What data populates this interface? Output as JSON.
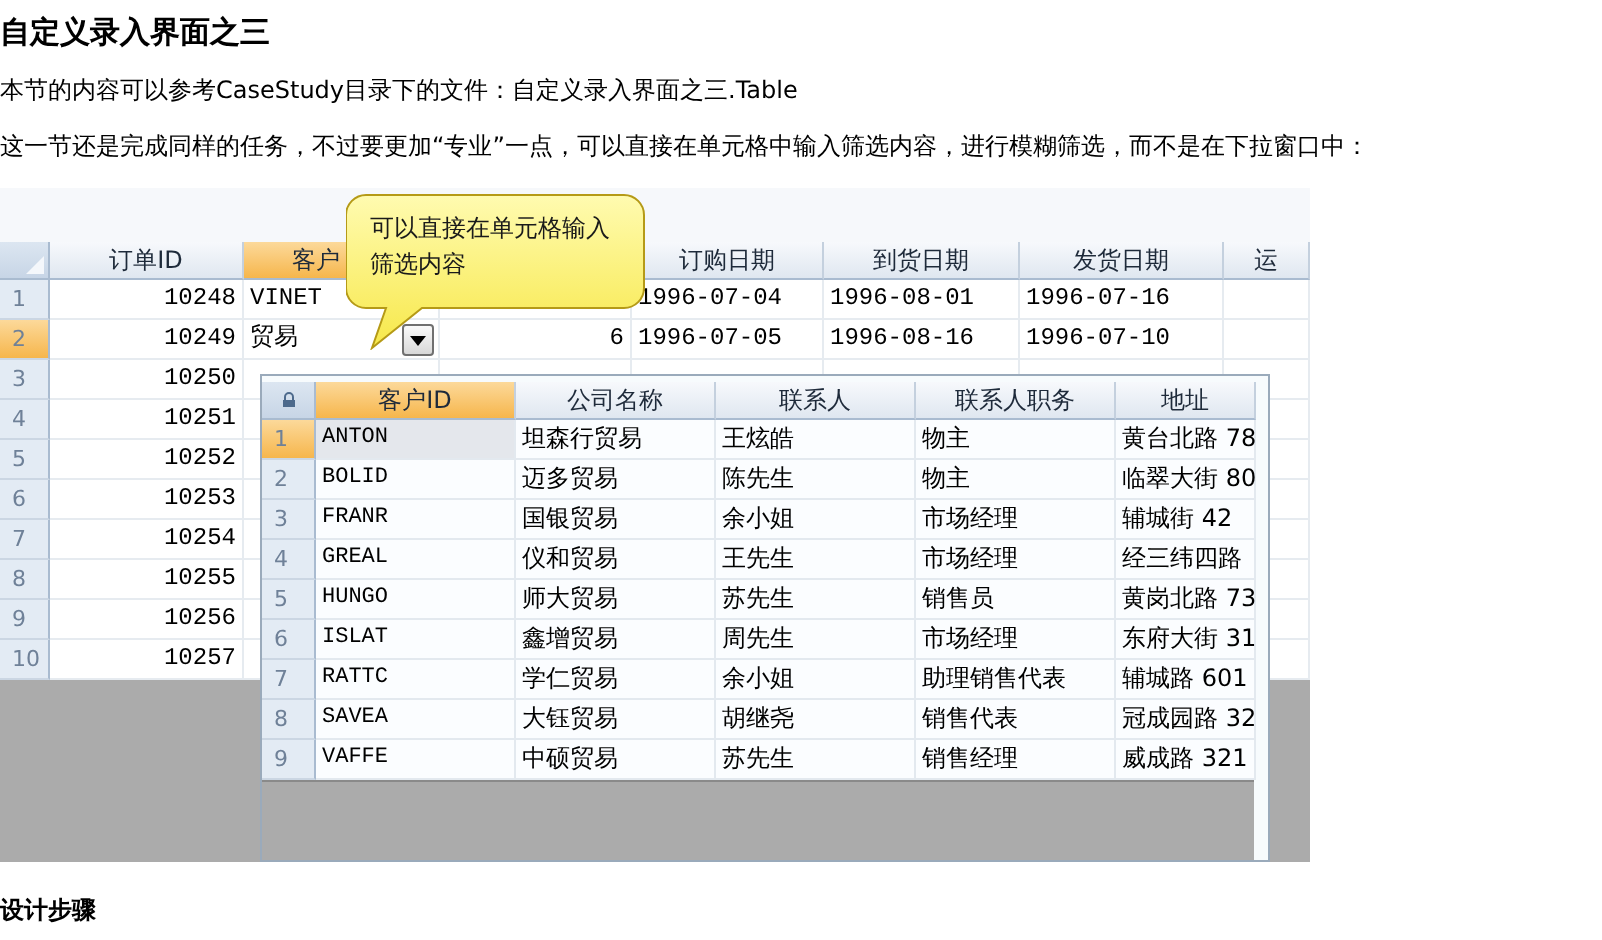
{
  "title": "自定义录入界面之三",
  "intro": "本节的内容可以参考CaseStudy目录下的文件：自定义录入界面之三.Table",
  "description": "这一节还是完成同样的任务，不过要更加“专业”一点，可以直接在单元格中输入筛选内容，进行模糊筛选，而不是在下拉窗口中：",
  "grid": {
    "columns": [
      {
        "label": "订单ID",
        "selected": false
      },
      {
        "label": "客户",
        "selected": true
      },
      {},
      {
        "label": "订购日期",
        "selected": false
      },
      {
        "label": "到货日期",
        "selected": false
      },
      {
        "label": "发货日期",
        "selected": false
      },
      {
        "label": "运",
        "selected": false
      }
    ],
    "rows": [
      {
        "header": "1",
        "selected": false,
        "order_id": "10248",
        "customer": "VINET",
        "order_date": "1996-07-04",
        "arrival_date": "1996-08-01",
        "ship_date": "1996-07-16"
      },
      {
        "header": "2",
        "selected": true,
        "order_id": "10249",
        "customer": "贸易",
        "column_3": "6",
        "order_date": "1996-07-05",
        "arrival_date": "1996-08-16",
        "ship_date": "1996-07-10"
      },
      {
        "header": "3",
        "selected": false,
        "order_id": "10250"
      },
      {
        "header": "4",
        "selected": false,
        "order_id": "10251"
      },
      {
        "header": "5",
        "selected": false,
        "order_id": "10252"
      },
      {
        "header": "6",
        "selected": false,
        "order_id": "10253"
      },
      {
        "header": "7",
        "selected": false,
        "order_id": "10254"
      },
      {
        "header": "8",
        "selected": false,
        "order_id": "10255"
      },
      {
        "header": "9",
        "selected": false,
        "order_id": "10256"
      },
      {
        "header": "10",
        "selected": false,
        "order_id": "10257"
      }
    ]
  },
  "callout": {
    "text": "可以直接在单元格输入筛选内容"
  },
  "dropdown": {
    "columns": [
      {
        "label": "客户ID",
        "selected": true
      },
      {
        "label": "公司名称",
        "selected": false
      },
      {
        "label": "联系人",
        "selected": false
      },
      {
        "label": "联系人职务",
        "selected": false
      },
      {
        "label": "地址",
        "selected": false
      }
    ],
    "rows": [
      {
        "header": "1",
        "selected": true,
        "cells": [
          "ANTON",
          "坦森行贸易",
          "王炫皓",
          "物主",
          "黄台北路 78"
        ]
      },
      {
        "header": "2",
        "selected": false,
        "cells": [
          "BOLID",
          "迈多贸易",
          "陈先生",
          "物主",
          "临翠大街 80"
        ]
      },
      {
        "header": "3",
        "selected": false,
        "cells": [
          "FRANR",
          "国银贸易",
          "余小姐",
          "市场经理",
          "辅城街 42"
        ]
      },
      {
        "header": "4",
        "selected": false,
        "cells": [
          "GREAL",
          "仪和贸易",
          "王先生",
          "市场经理",
          "经三纬四路"
        ]
      },
      {
        "header": "5",
        "selected": false,
        "cells": [
          "HUNGO",
          "师大贸易",
          "苏先生",
          "销售员",
          "黄岗北路 73"
        ]
      },
      {
        "header": "6",
        "selected": false,
        "cells": [
          "ISLAT",
          "鑫增贸易",
          "周先生",
          "市场经理",
          "东府大街 31"
        ]
      },
      {
        "header": "7",
        "selected": false,
        "cells": [
          "RATTC",
          "学仁贸易",
          "余小姐",
          "助理销售代表",
          "辅城路 601"
        ]
      },
      {
        "header": "8",
        "selected": false,
        "cells": [
          "SAVEA",
          "大钰贸易",
          "胡继尧",
          "销售代表",
          "冠成园路 32"
        ]
      },
      {
        "header": "9",
        "selected": false,
        "cells": [
          "VAFFE",
          "中硕贸易",
          "苏先生",
          "销售经理",
          "威成路 321"
        ]
      }
    ]
  },
  "footer": "设计步骤"
}
